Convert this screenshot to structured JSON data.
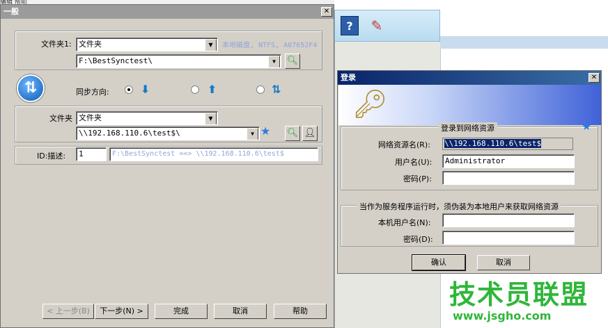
{
  "background": {
    "menu_fragment": "编辑   帮助"
  },
  "main_dialog": {
    "title": "一般",
    "folder1_label": "文件夹1:",
    "folder1_type": "文件夹",
    "disk_info": "本地磁盘, NTFS, A07652F4",
    "folder1_path": "F:\\BestSynctest\\",
    "sync_direction_label": "同步方向:",
    "folder2_label": "文件夹",
    "folder2_type": "文件夹",
    "folder2_path": "\\\\192.168.110.6\\test$\\",
    "id_desc_label": "ID:描述:",
    "id_value": "1",
    "desc_value": "F:\\BestSynctest ==> \\\\192.168.110.6\\test$",
    "buttons": {
      "prev": "< 上一步(B)",
      "next": "下一步(N) >",
      "finish": "完成",
      "cancel": "取消",
      "help": "帮助"
    }
  },
  "login_dialog": {
    "title": "登录",
    "group1_title": "登录到网络资源",
    "resource_label": "网络资源名(R):",
    "resource_value": "\\\\192.168.110.6\\test$",
    "user_label": "用户名(U):",
    "user_value": "Administrator",
    "password_label": "密码(P):",
    "password_value": "",
    "group2_title": "当作为服务程序运行时，须伪装为本地用户来获取网络资源",
    "local_user_label": "本机用户名(N):",
    "local_user_value": "",
    "local_password_label": "密码(D):",
    "local_password_value": "",
    "ok": "确认",
    "cancel": "取消"
  },
  "watermark": {
    "text": "技术员联盟",
    "url": "www.jsgho.com"
  }
}
